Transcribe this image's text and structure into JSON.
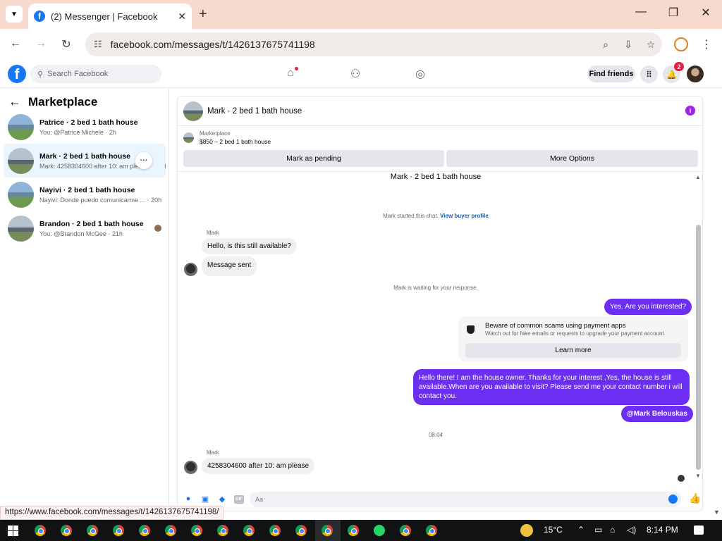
{
  "browser": {
    "tab_title": "(2) Messenger | Facebook",
    "tab_favicon": "f",
    "tab_close": "✕",
    "new_tab": "+",
    "url": "facebook.com/messages/t/1426137675741198",
    "status_url": "https://www.facebook.com/messages/t/1426137675741198/"
  },
  "fb": {
    "logo": "f",
    "search_placeholder": "Search Facebook",
    "find_friends": "Find friends",
    "notif_count": "2"
  },
  "left": {
    "title": "Marketplace",
    "conversations": [
      {
        "name": "Patrice · 2 bed 1 bath house",
        "preview": "You: @Patrice Michele · 2h"
      },
      {
        "name": "Mark · 2 bed 1 bath house",
        "preview": "Mark: 4258304600 after 10: am pleas",
        "preview_tail": "h",
        "more": "···"
      },
      {
        "name": "Nayivi · 2 bed 1 bath house",
        "preview": "Nayivi: Donde puedo comunicarme ... · 20h"
      },
      {
        "name": "Brandon · 2 bed 1 bath house",
        "preview": "You: @Brandon McGee · 21h"
      }
    ]
  },
  "chat": {
    "header_name": "Mark · 2 bed 1 bath house",
    "info_icon": "i",
    "listing_source": "Marketplace",
    "listing_title": "$850 – 2 bed 1 bath house",
    "mark_pending": "Mark as pending",
    "more_options": "More Options",
    "thread_title": "Mark · 2 bed 1 bath house",
    "started": "Mark started this chat.",
    "view_buyer": "View buyer profile",
    "sender_name": "Mark",
    "msg1": "Hello, is this still available?",
    "msg2": "Message sent",
    "waiting": "Mark is waiting for your response.",
    "out1": "Yes. Are you interested?",
    "scam_title": "Beware of common scams using payment apps",
    "scam_body": "Watch out for fake emails or requests to upgrade your payment account.",
    "learn_more": "Learn more",
    "out2": "Hello there! I am the house owner. Thanks for your interest ,Yes, the house is still available.When are you available to visit? Please send me your contact number i will contact you.",
    "out3": "@Mark Belouskas",
    "time": "08:04",
    "sender_name2": "Mark",
    "msg3": "4258304600 after 10: am please",
    "composer_placeholder": "Aa",
    "gif": "GIF"
  },
  "taskbar": {
    "temp": "15°C",
    "clock": "8:14 PM"
  }
}
